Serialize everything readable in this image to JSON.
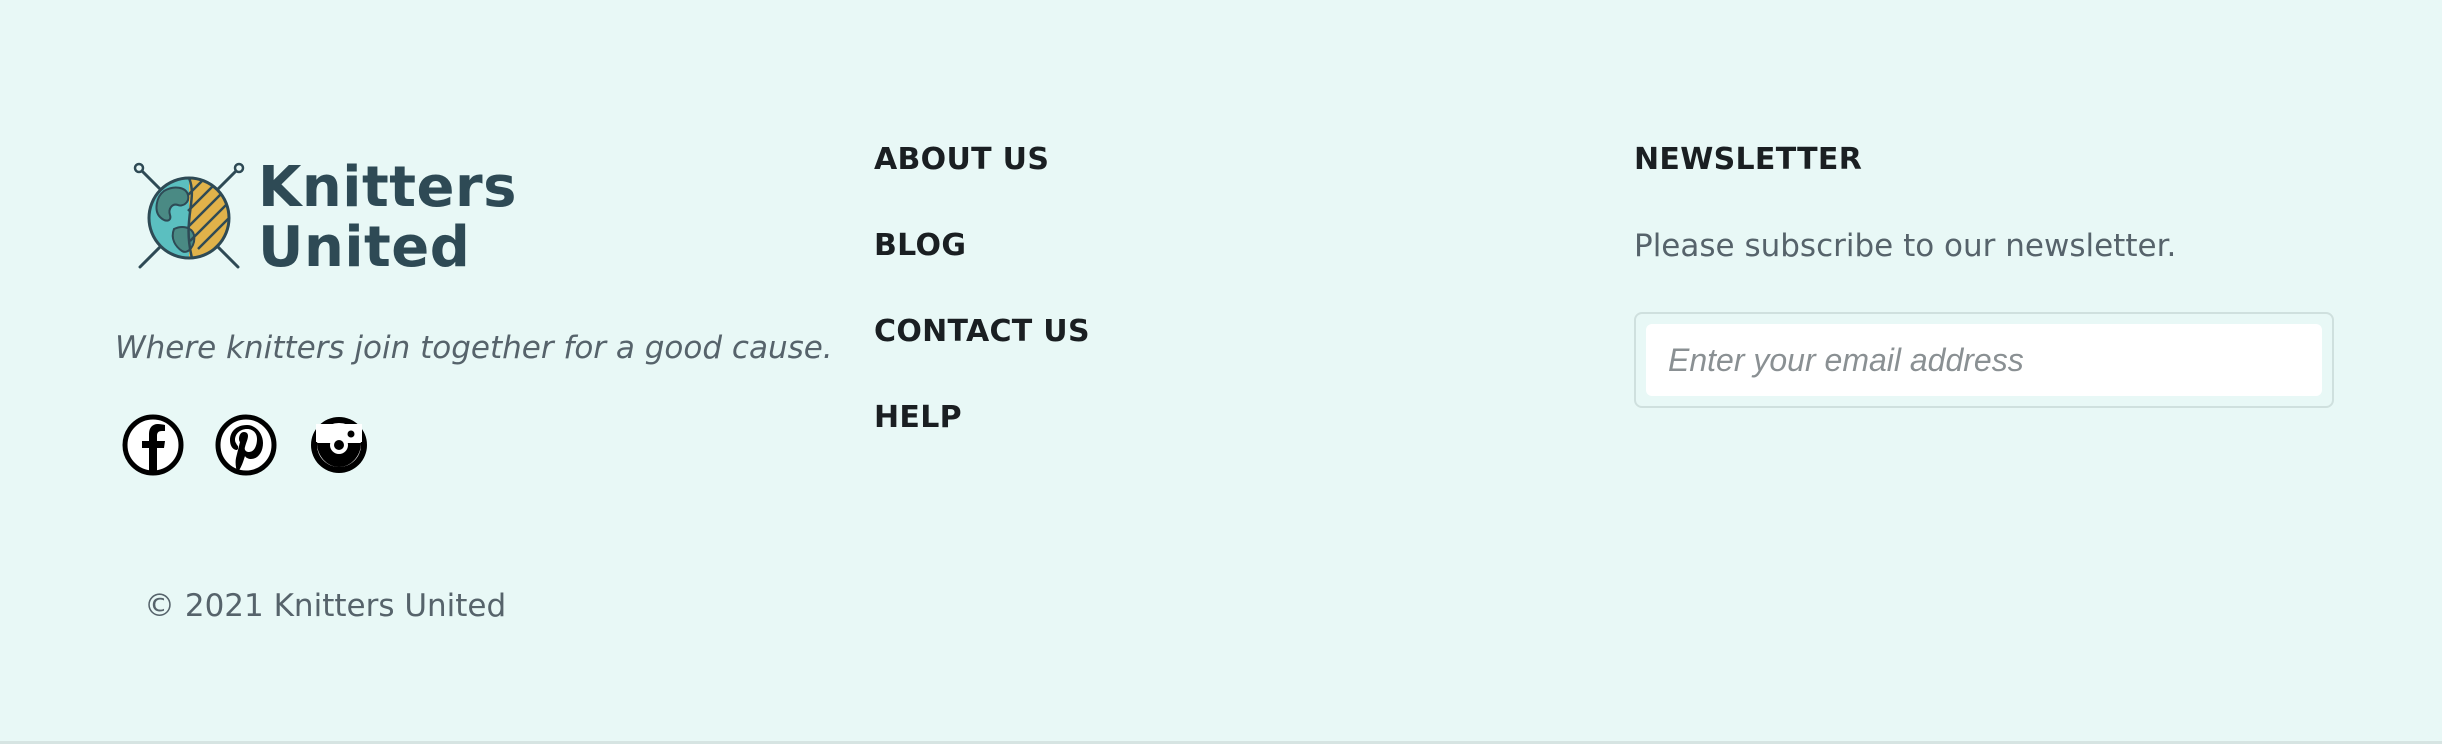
{
  "brand": {
    "name_line1": "Knitters",
    "name_line2": "United",
    "tagline": "Where knitters join together for a good cause.",
    "colors": {
      "text": "#2e4a55",
      "globe_teal": "#5bbfc0",
      "yarn_gold": "#e0b24a",
      "land": "#4a8a84"
    }
  },
  "social": [
    {
      "icon": "facebook-icon"
    },
    {
      "icon": "pinterest-icon"
    },
    {
      "icon": "instagram-icon"
    }
  ],
  "copyright": "© 2021 Knitters United",
  "nav": {
    "about": "ABOUT US",
    "blog": "BLOG",
    "contact": "CONTACT US",
    "help": "HELP"
  },
  "newsletter": {
    "heading": "NEWSLETTER",
    "text": "Please subscribe to our newsletter.",
    "email_placeholder": "Enter your email address",
    "email_value": ""
  },
  "colors": {
    "background": "#e8f8f6",
    "heading": "#1a1f22",
    "body_text": "#56636b"
  }
}
